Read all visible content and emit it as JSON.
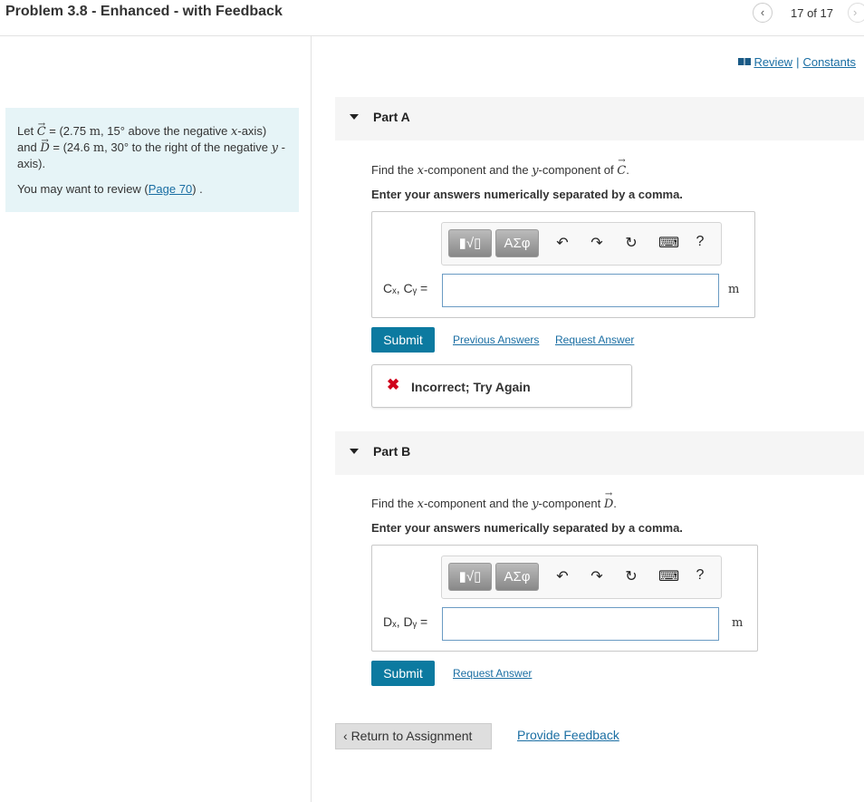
{
  "header": {
    "title": "Problem 3.8 - Enhanced - with Feedback",
    "prev_glyph": "‹",
    "counter": "17 of 17",
    "next_glyph": "›"
  },
  "top_links": {
    "review": "Review",
    "separator": "|",
    "constants": "Constants"
  },
  "problem": {
    "let": "Let",
    "c_symbol": "C",
    "c_eq": " = (2.75 ",
    "c_unit": "m",
    "c_rest": ", 15° above the negative ",
    "c_axis": "x",
    "c_end": "-axis)",
    "and": "and",
    "d_symbol": "D",
    "d_eq": " = (24.6 ",
    "d_unit": "m",
    "d_rest": ", 30° to the right of the negative ",
    "d_axis": "y",
    "d_end": "-axis).",
    "review_text": "You may want to review (",
    "review_link": "Page 70",
    "review_end": ") ."
  },
  "part_a": {
    "label": "Part A",
    "question_start": "Find the ",
    "q_x": "x",
    "question_mid": "-component and the ",
    "q_y": "y",
    "question_end": "-component of ",
    "q_vec": "C",
    "q_period": ".",
    "instruction": "Enter your answers numerically separated by a comma.",
    "toolbar": {
      "template_label": "▮√▯",
      "greek_label": "ΑΣφ",
      "undo": "↶",
      "redo": "↷",
      "reset": "↻",
      "keyboard": "⌨",
      "help": "?"
    },
    "input_label": "Cₓ, Cᵧ =",
    "input_value": "",
    "unit": "m",
    "submit": "Submit",
    "previous_answers": "Previous Answers",
    "request_answer": "Request Answer",
    "feedback_icon": "✖",
    "feedback": "Incorrect; Try Again"
  },
  "part_b": {
    "label": "Part B",
    "question_start": "Find the ",
    "q_x": "x",
    "question_mid": "-component and the ",
    "q_y": "y",
    "question_end": "-component ",
    "q_vec": "D",
    "q_period": ".",
    "instruction": "Enter your answers numerically separated by a comma.",
    "toolbar": {
      "template_label": "▮√▯",
      "greek_label": "ΑΣφ",
      "undo": "↶",
      "redo": "↷",
      "reset": "↻",
      "keyboard": "⌨",
      "help": "?"
    },
    "input_label": "Dₓ, Dᵧ =",
    "input_value": "",
    "unit": "m",
    "submit": "Submit",
    "request_answer": "Request Answer"
  },
  "footer": {
    "return": "Return to Assignment",
    "return_glyph": "‹",
    "provide_feedback": "Provide Feedback"
  }
}
